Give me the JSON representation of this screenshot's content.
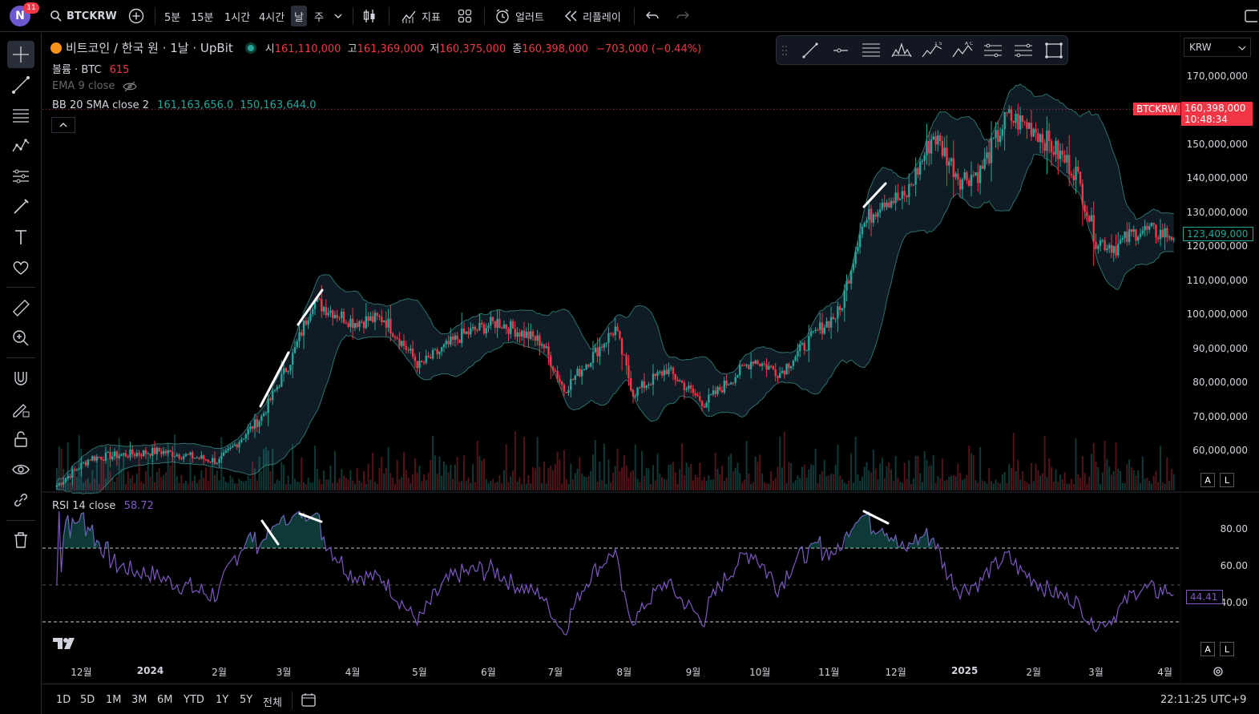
{
  "topbar": {
    "avatar_letter": "N",
    "notifications": "11",
    "symbol": "BTCKRW",
    "timeframes": [
      "5분",
      "15분",
      "1시간",
      "4시간",
      "날",
      "주"
    ],
    "active_timeframe": "날",
    "indicators_label": "지표",
    "alert_label": "얼러트",
    "replay_label": "리플레이"
  },
  "legend": {
    "title": "비트코인 / 한국 원 · 1날 · UpBit",
    "open_label": "시",
    "open": "161,110,000",
    "high_label": "고",
    "high": "161,369,000",
    "low_label": "저",
    "low": "160,375,000",
    "close_label": "종",
    "close": "160,398,000",
    "change": "−703,000 (−0.44%)",
    "volume_label": "볼륨 · BTC",
    "volume": "615",
    "ema_label": "EMA 9 close",
    "bb_label": "BB 20 SMA close 2",
    "bb_upper": "161,163,656.0",
    "bb_lower": "150,163,644.0"
  },
  "currency": "KRW",
  "price_axis": [
    "170,000,000",
    "160,000,000",
    "150,000,000",
    "140,000,000",
    "130,000,000",
    "120,000,000",
    "110,000,000",
    "100,000,000",
    "90,000,000",
    "80,000,000",
    "70,000,000",
    "60,000,000"
  ],
  "last_price": {
    "symbol": "BTCKRW",
    "price": "160,398,000",
    "countdown": "10:48:34"
  },
  "crosshair_price": "123,409,000",
  "rsi": {
    "label": "RSI 14 close",
    "value": "58.72",
    "axis": [
      "80.00",
      "60.00",
      "40.00"
    ],
    "crosshair": "44.41"
  },
  "time_axis": [
    "12월",
    "2024",
    "2월",
    "3월",
    "4월",
    "5월",
    "6월",
    "7월",
    "8월",
    "9월",
    "10월",
    "11월",
    "12월",
    "2025",
    "2월",
    "3월",
    "4월"
  ],
  "range_buttons": [
    "1D",
    "5D",
    "1M",
    "3M",
    "6M",
    "YTD",
    "1Y",
    "5Y",
    "전체"
  ],
  "clock": "22:11:25 UTC+9",
  "colors": {
    "up": "#26a69a",
    "down": "#f23645",
    "bb_fill": "#0f1c26",
    "bb_line": "#2f6f6a",
    "rsi": "#7e57c2"
  },
  "chart_data": {
    "type": "candlestick",
    "symbol": "BTCKRW",
    "ylim": [
      50000000,
      175000000
    ],
    "x_months": [
      "2023-11",
      "2023-12",
      "2024-01",
      "2024-02",
      "2024-03",
      "2024-04",
      "2024-05",
      "2024-06",
      "2024-07",
      "2024-08",
      "2024-09",
      "2024-10",
      "2024-11",
      "2024-12",
      "2025-01",
      "2025-02",
      "2025-03",
      "2025-04"
    ],
    "price_path": [
      [
        "2023-11-20",
        50000000
      ],
      [
        "2023-12-05",
        58000000
      ],
      [
        "2024-01-05",
        60000000
      ],
      [
        "2024-02-01",
        57000000
      ],
      [
        "2024-02-20",
        70000000
      ],
      [
        "2024-03-05",
        88000000
      ],
      [
        "2024-03-14",
        104000000
      ],
      [
        "2024-04-01",
        98000000
      ],
      [
        "2024-04-15",
        99000000
      ],
      [
        "2024-05-01",
        85000000
      ],
      [
        "2024-05-20",
        94000000
      ],
      [
        "2024-06-05",
        98000000
      ],
      [
        "2024-06-25",
        92000000
      ],
      [
        "2024-07-05",
        78000000
      ],
      [
        "2024-07-28",
        96000000
      ],
      [
        "2024-08-05",
        77000000
      ],
      [
        "2024-08-20",
        84000000
      ],
      [
        "2024-09-06",
        74000000
      ],
      [
        "2024-09-28",
        87000000
      ],
      [
        "2024-10-10",
        83000000
      ],
      [
        "2024-10-28",
        96000000
      ],
      [
        "2024-11-06",
        101000000
      ],
      [
        "2024-11-15",
        125000000
      ],
      [
        "2024-11-25",
        134000000
      ],
      [
        "2024-12-05",
        134000000
      ],
      [
        "2024-12-18",
        153000000
      ],
      [
        "2024-12-30",
        140000000
      ],
      [
        "2025-01-08",
        142000000
      ],
      [
        "2025-01-20",
        158000000
      ],
      [
        "2025-02-01",
        155000000
      ],
      [
        "2025-02-20",
        142000000
      ],
      [
        "2025-03-01",
        122000000
      ],
      [
        "2025-03-10",
        120000000
      ],
      [
        "2025-03-20",
        125000000
      ],
      [
        "2025-04-05",
        123409000
      ]
    ],
    "rsi_ylim": [
      20,
      100
    ],
    "rsi_levels": [
      70,
      50,
      30
    ]
  }
}
